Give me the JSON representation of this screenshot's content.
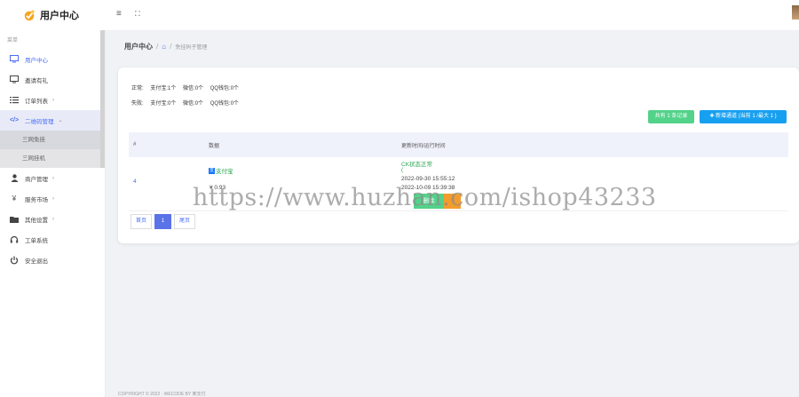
{
  "app": {
    "title": "用户中心"
  },
  "sidebar": {
    "caption": "菜单",
    "items": [
      {
        "label": "用户中心",
        "icon": "monitor-icon"
      },
      {
        "label": "邀请有礼",
        "icon": "monitor-icon"
      },
      {
        "label": "订单列表",
        "icon": "list-icon"
      },
      {
        "label": "二维码管理",
        "icon": "code-icon"
      },
      {
        "label": "商户管理",
        "icon": "user-icon"
      },
      {
        "label": "服务市场",
        "icon": "yen-icon"
      },
      {
        "label": "其他设置",
        "icon": "folder-icon"
      },
      {
        "label": "工单系统",
        "icon": "headset-icon"
      },
      {
        "label": "安全退出",
        "icon": "power-icon"
      }
    ],
    "submenu": [
      "三网免挂",
      "三网挂机"
    ]
  },
  "header": {
    "page_title": "用户中心",
    "crumb": "免挂码子管理"
  },
  "stats": {
    "normal_label": "正常:",
    "normal": [
      "支付宝:1个",
      "微信:0个",
      "QQ钱包:0个"
    ],
    "fail_label": "失败:",
    "fail": [
      "支付宝:0个",
      "微信:0个",
      "QQ钱包:0个"
    ]
  },
  "buttons": {
    "total": "共有 1 条记录",
    "add": "✚ 新增通道 (当前 1 /最大 1 )"
  },
  "table": {
    "headers": [
      "#",
      "数据",
      "更新时间/运行时间"
    ],
    "rows": [
      {
        "id": "4",
        "channel": "支付宝",
        "amount": "¥ 0.93",
        "status": "CK状态正常",
        "status_sub": "(",
        "updated": "2022-09-30 15:55:12",
        "runtime": "2022-10-09 15:39:38",
        "action": "删除"
      }
    ]
  },
  "pager": {
    "first": "首页",
    "current": "1",
    "last": "尾页"
  },
  "footer": {
    "text": "COPYRIGHT © 2022 · WECODE BY 某支付"
  },
  "watermark": "https://www.huzhan.com/ishop43233",
  "colors": {
    "accent": "#4a6cf7",
    "green": "#53d28a",
    "blue": "#18a0f0",
    "alipay": "#1677ff"
  }
}
